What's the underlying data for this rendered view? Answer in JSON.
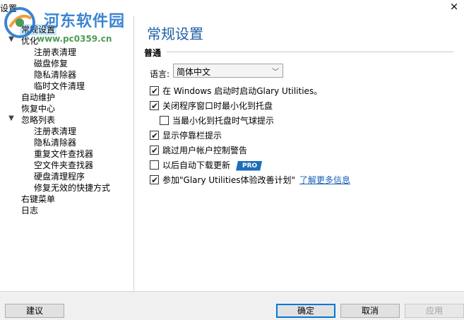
{
  "window": {
    "title": "设置",
    "close_glyph": "×"
  },
  "watermark": {
    "site_name": "河东软件园",
    "url": "www.pc0359.cn"
  },
  "sidebar": {
    "items": [
      {
        "label": "常规设置",
        "selected": true
      },
      {
        "label": "优化",
        "expanded": true
      },
      {
        "label": "注册表清理"
      },
      {
        "label": "磁盘修复"
      },
      {
        "label": "隐私清除器"
      },
      {
        "label": "临时文件清理"
      },
      {
        "label": "自动维护"
      },
      {
        "label": "恢复中心"
      },
      {
        "label": "忽略列表",
        "expanded": true
      },
      {
        "label": "注册表清理"
      },
      {
        "label": "隐私清除器"
      },
      {
        "label": "重复文件查找器"
      },
      {
        "label": "空文件夹查找器"
      },
      {
        "label": "硬盘清理程序"
      },
      {
        "label": "修复无效的快捷方式"
      },
      {
        "label": "右键菜单"
      },
      {
        "label": "日志"
      }
    ]
  },
  "main": {
    "title": "常规设置",
    "section": "普通",
    "language": {
      "label": "语言:",
      "value": "简体中文"
    },
    "options": [
      {
        "label": "在 Windows 启动时启动Glary Utilities。",
        "checked": true
      },
      {
        "label": "关闭程序窗口时最小化到托盘",
        "checked": true
      },
      {
        "label": "当最小化到托盘时气球提示",
        "checked": false
      },
      {
        "label": "显示停靠栏提示",
        "checked": true
      },
      {
        "label": "跳过用户帐户控制警告",
        "checked": true
      },
      {
        "label": "以后自动下载更新",
        "checked": false,
        "badge": "PRO"
      },
      {
        "label": "参加\"Glary Utilities体验改善计划\"",
        "checked": true,
        "link": "了解更多信息"
      }
    ]
  },
  "buttons": {
    "suggest": "建议",
    "ok": "确定",
    "cancel": "取消",
    "apply": "应用"
  },
  "colors": {
    "accent": "#1f5fa8",
    "selection": "#cce8ff",
    "pro_badge": "#1d6fb8",
    "link": "#1a5fb4"
  }
}
